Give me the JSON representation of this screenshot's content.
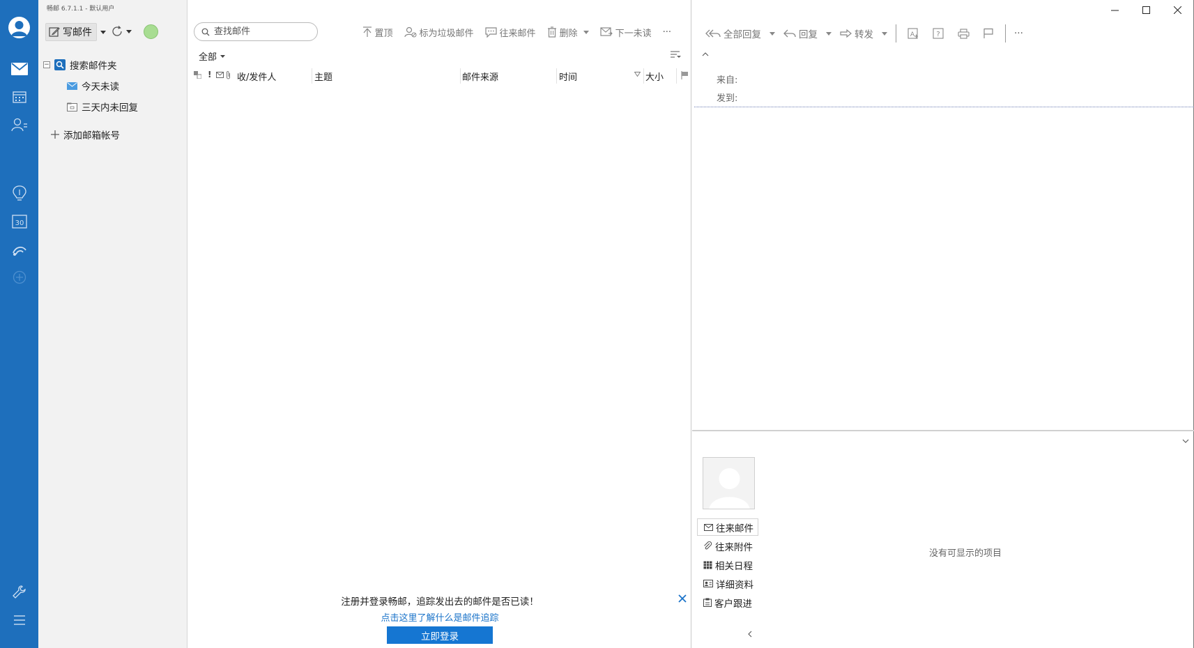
{
  "app": {
    "title": "畅邮 6.7.1.1  -  默认用户"
  },
  "rail": {
    "items": [
      {
        "name": "mail-icon"
      },
      {
        "name": "calendar-icon"
      },
      {
        "name": "contacts-icon"
      },
      {
        "name": "idea-icon"
      },
      {
        "name": "date-30-icon"
      },
      {
        "name": "feed-icon"
      },
      {
        "name": "add-icon"
      },
      {
        "name": "tools-icon"
      },
      {
        "name": "menu-icon"
      }
    ],
    "accent": "#1e6fbc"
  },
  "folders": {
    "compose_label": "写邮件",
    "tree": {
      "root_label": "搜索邮件夹",
      "children": [
        "今天未读",
        "三天内未回复"
      ]
    },
    "add_account_label": "添加邮箱帐号",
    "status_color": "#a8dd92"
  },
  "list": {
    "search_placeholder": "查找邮件",
    "toolbar": {
      "pin": "置顶",
      "spam": "标为垃圾邮件",
      "correspondence": "往来邮件",
      "delete": "删除",
      "next_unread": "下一未读",
      "more": "···"
    },
    "filter_label": "全部",
    "columns": {
      "sender": "收/发件人",
      "subject": "主题",
      "source": "邮件来源",
      "time": "时间",
      "size": "大小"
    },
    "promo": {
      "text": "注册并登录畅邮，追踪发出去的邮件是否已读！",
      "link": "点击这里了解什么是邮件追踪",
      "button": "立即登录"
    }
  },
  "reader": {
    "toolbar": {
      "reply_all": "全部回复",
      "reply": "回复",
      "forward": "转发",
      "more": "···"
    },
    "header": {
      "from_label": "来自:",
      "to_label": "发到:"
    },
    "side_tabs": [
      "往来邮件",
      "往来附件",
      "相关日程",
      "详细资料",
      "客户跟进"
    ],
    "empty_message": "没有可显示的项目"
  }
}
